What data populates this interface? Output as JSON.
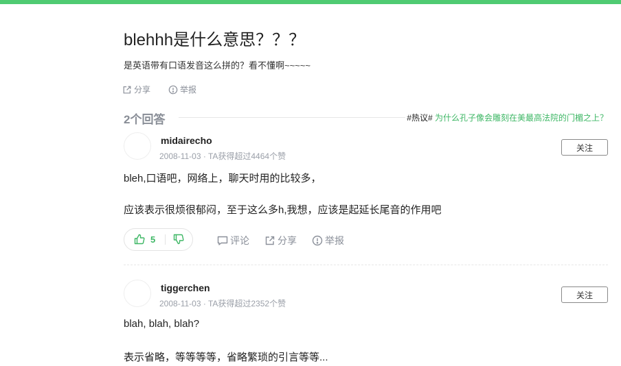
{
  "question": {
    "title": "blehhh是什么意思？？？",
    "description": "是英语带有口语发音这么拼的？看不懂啊~~~~~",
    "share_label": "分享",
    "report_label": "举报"
  },
  "answers_header": {
    "count_label": "2个回答",
    "hot_tag": "#热议#",
    "hot_link": " 为什么孔子像会雕刻在美最高法院的门楣之上？"
  },
  "answers": [
    {
      "username": "midairecho",
      "meta": "2008-11-03 · TA获得超过4464个赞",
      "follow_label": "关注",
      "paragraphs": [
        "bleh,口语吧，网络上，聊天时用的比较多，",
        "应该表示很烦很郁闷，至于这么多h,我想，应该是起延长尾音的作用吧"
      ],
      "likes": "5",
      "comment_label": "评论",
      "share_label": "分享",
      "report_label": "举报"
    },
    {
      "username": "tiggerchen",
      "meta": "2008-11-03 · TA获得超过2352个赞",
      "follow_label": "关注",
      "paragraphs": [
        "blah, blah, blah?",
        "表示省略，等等等等，省略繁琐的引言等等..."
      ]
    }
  ],
  "colors": {
    "accent": "#4fcb72",
    "link": "#3eb765",
    "muted": "#8a8f99"
  }
}
